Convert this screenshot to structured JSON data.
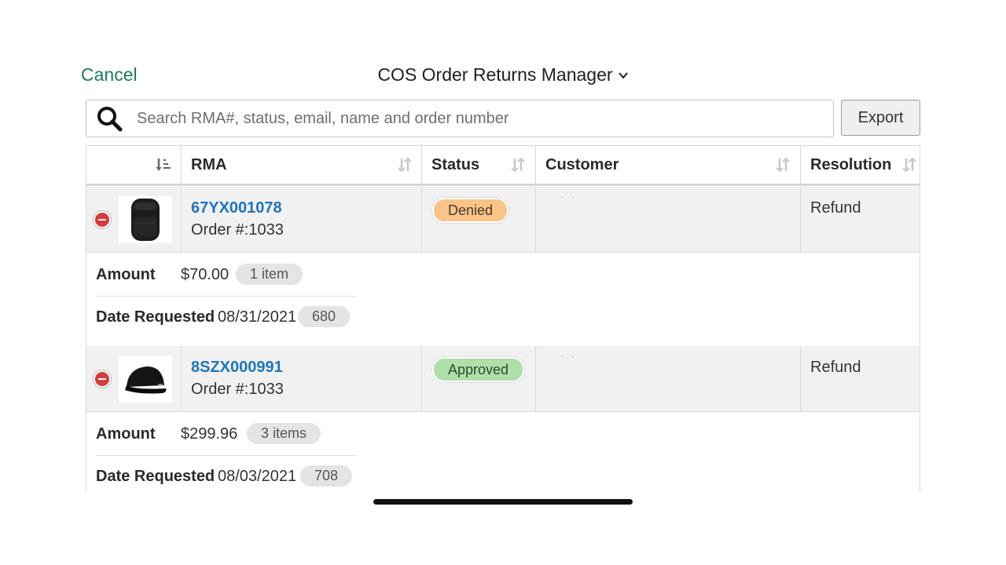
{
  "header": {
    "cancel_label": "Cancel",
    "app_title": "COS Order Returns Manager"
  },
  "search": {
    "placeholder": "Search RMA#, status, email, name and order number",
    "value": ""
  },
  "toolbar": {
    "export_label": "Export"
  },
  "table": {
    "columns": [
      {
        "label": ""
      },
      {
        "label": "RMA"
      },
      {
        "label": "Status"
      },
      {
        "label": "Customer"
      },
      {
        "label": "Resolution"
      }
    ],
    "rows": [
      {
        "thumb_icon": "backpack-icon",
        "rma": "67YX001078",
        "order": "Order #:1033",
        "status": "Denied",
        "status_color": "#f9c48a",
        "customer": ". .",
        "resolution": "Refund",
        "amount_label": "Amount",
        "amount": "$70.00",
        "items": "1 item",
        "date_label": "Date Requested",
        "date": "08/31/2021",
        "days": "680"
      },
      {
        "thumb_icon": "cap-icon",
        "rma": "8SZX000991",
        "order": "Order #:1033",
        "status": "Approved",
        "status_color": "#aedfa9",
        "customer": ". .",
        "resolution": "Refund",
        "amount_label": "Amount",
        "amount": "$299.96",
        "items": "3 items",
        "date_label": "Date Requested",
        "date": "08/03/2021",
        "days": "708"
      }
    ]
  },
  "colors": {
    "accent_green": "#1e7b5b",
    "link_blue": "#1d75c0",
    "remove_red": "#d93a3a"
  }
}
